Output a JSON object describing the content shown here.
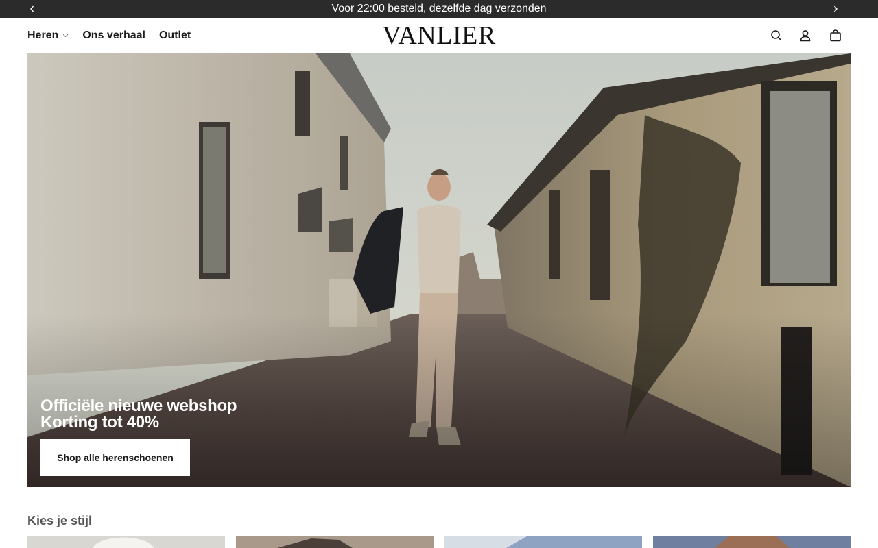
{
  "announcement": {
    "text": "Voor 22:00 besteld, dezelfde dag verzonden",
    "prev_icon": "chevron-left-icon",
    "next_icon": "chevron-right-icon"
  },
  "header": {
    "nav": [
      {
        "label": "Heren",
        "has_dropdown": true
      },
      {
        "label": "Ons verhaal"
      },
      {
        "label": "Outlet"
      }
    ],
    "logo": "VANLIER",
    "icons": [
      "search-icon",
      "account-icon",
      "cart-icon"
    ]
  },
  "hero": {
    "title_line1": "Officiële nieuwe webshop",
    "title_line2": "Korting tot 40%",
    "cta_label": "Shop alle herenschoenen"
  },
  "styles_section": {
    "title": "Kies je stijl"
  },
  "colors": {
    "announcement_bg": "#2b2b2b",
    "text": "#1c1c1c",
    "section_title": "#555555"
  }
}
